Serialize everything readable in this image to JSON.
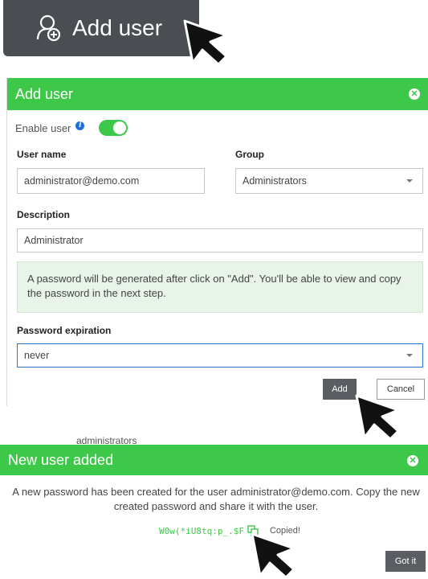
{
  "top_button": {
    "label": "Add user"
  },
  "add_dialog": {
    "title": "Add user",
    "enable_label": "Enable user",
    "username_label": "User name",
    "username_value": "administrator@demo.com",
    "group_label": "Group",
    "group_value": "Administrators",
    "description_label": "Description",
    "description_value": "Administrator",
    "notice": "A password will be generated after click on \"Add\". You'll be able to view and copy the password in the next step.",
    "expiration_label": "Password expiration",
    "expiration_value": "never",
    "add_label": "Add",
    "cancel_label": "Cancel"
  },
  "partial_text": "administrators",
  "added_dialog": {
    "title": "New user added",
    "message": "A new password has been created for the user administrator@demo.com. Copy the new created password and share it with the user.",
    "password": "W0w(*iU8tq:p_.$F",
    "copied_label": "Copied!",
    "got_it_label": "Got it"
  },
  "colors": {
    "accent_green": "#3ec849",
    "button_dark": "#4a4d52",
    "info_blue": "#1e6fd9"
  }
}
